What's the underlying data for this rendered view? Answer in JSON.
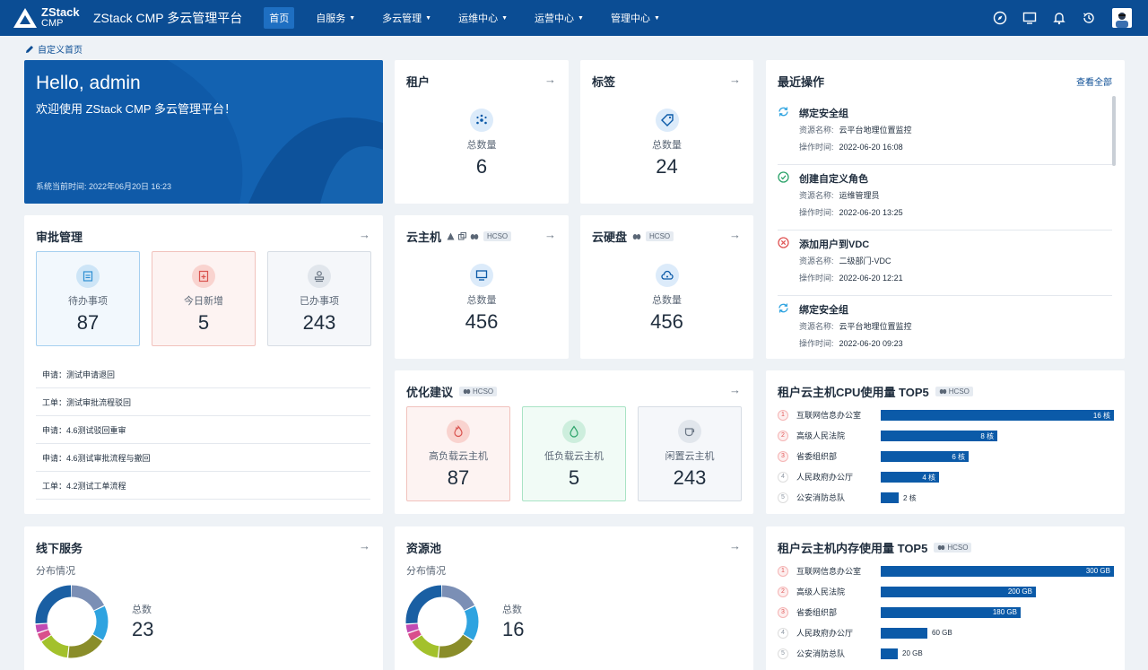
{
  "header": {
    "logo_line1": "ZStack",
    "logo_line2": "CMP",
    "app_title": "ZStack CMP 多云管理平台",
    "nav": [
      {
        "label": "首页"
      },
      {
        "label": "自服务"
      },
      {
        "label": "多云管理"
      },
      {
        "label": "运维中心"
      },
      {
        "label": "运营中心"
      },
      {
        "label": "管理中心"
      }
    ],
    "icons": [
      "compass-icon",
      "monitor-icon",
      "bell-icon",
      "history-icon",
      "avatar"
    ]
  },
  "customize_label": "自定义首页",
  "hello": {
    "title": "Hello, admin",
    "subtitle": "欢迎使用 ZStack CMP 多云管理平台！",
    "time": "系统当前时间:  2022年06月20日 16:23"
  },
  "tenant": {
    "title": "租户",
    "label": "总数量",
    "value": "6"
  },
  "tag": {
    "title": "标签",
    "label": "总数量",
    "value": "24"
  },
  "vm": {
    "title": "云主机",
    "label": "总数量",
    "value": "456",
    "badge": "HCSO"
  },
  "disk": {
    "title": "云硬盘",
    "label": "总数量",
    "value": "456",
    "badge": "HCSO"
  },
  "approval": {
    "title": "审批管理",
    "boxes": [
      {
        "label": "待办事项",
        "value": "87"
      },
      {
        "label": "今日新增",
        "value": "5"
      },
      {
        "label": "已办事项",
        "value": "243"
      }
    ],
    "items": [
      {
        "text": "申请：测试申请退回"
      },
      {
        "text": "工单：测试审批流程驳回"
      },
      {
        "text": "申请：4.6测试驳回重审"
      },
      {
        "text": "申请：4.6测试审批流程与撤回"
      },
      {
        "text": "工单：4.2测试工单流程"
      }
    ]
  },
  "optimize": {
    "title": "优化建议",
    "badge": "HCSO",
    "boxes": [
      {
        "label": "高负载云主机",
        "value": "87"
      },
      {
        "label": "低负载云主机",
        "value": "5"
      },
      {
        "label": "闲置云主机",
        "value": "243"
      }
    ]
  },
  "recent": {
    "title": "最近操作",
    "view_all": "查看全部",
    "res_key": "资源名称:",
    "time_key": "操作时间:",
    "ops": [
      {
        "name": "绑定安全组",
        "resource": "云平台地理位置监控",
        "time": "2022-06-20 16:08",
        "status": "sync"
      },
      {
        "name": "创建自定义角色",
        "resource": "运维管理员",
        "time": "2022-06-20 13:25",
        "status": "success"
      },
      {
        "name": "添加用户到VDC",
        "resource": "二级部门-VDC",
        "time": "2022-06-20 12:21",
        "status": "fail"
      },
      {
        "name": "绑定安全组",
        "resource": "云平台地理位置监控",
        "time": "2022-06-20 09:23",
        "status": "sync"
      }
    ]
  },
  "cpu_top5": {
    "title": "租户云主机CPU使用量 TOP5",
    "badge": "HCSO",
    "rows": [
      {
        "rank": "1",
        "name": "互联网信息办公室",
        "value": 16,
        "label": "16 核"
      },
      {
        "rank": "2",
        "name": "高级人民法院",
        "value": 8,
        "label": "8 核"
      },
      {
        "rank": "3",
        "name": "省委组织部",
        "value": 6,
        "label": "6 核"
      },
      {
        "rank": "4",
        "name": "人民政府办公厅",
        "value": 4,
        "label": "4 核"
      },
      {
        "rank": "5",
        "name": "公安消防总队",
        "value": 1.2,
        "label": "2 核"
      }
    ],
    "max": 16
  },
  "mem_top5": {
    "title": "租户云主机内存使用量 TOP5",
    "badge": "HCSO",
    "rows": [
      {
        "rank": "1",
        "name": "互联网信息办公室",
        "value": 300,
        "label": "300 GB"
      },
      {
        "rank": "2",
        "name": "高级人民法院",
        "value": 200,
        "label": "200 GB"
      },
      {
        "rank": "3",
        "name": "省委组织部",
        "value": 180,
        "label": "180 GB"
      },
      {
        "rank": "4",
        "name": "人民政府办公厅",
        "value": 60,
        "label": "60 GB"
      },
      {
        "rank": "5",
        "name": "公安消防总队",
        "value": 22,
        "label": "20 GB"
      }
    ],
    "max": 300
  },
  "offline": {
    "title": "线下服务",
    "dist_label": "分布情况",
    "total_label": "总数",
    "total": "23",
    "segments": [
      {
        "value": 18,
        "color": "#7b8fb5"
      },
      {
        "value": 16,
        "color": "#2ea3e0"
      },
      {
        "value": 18,
        "color": "#8a8d2a"
      },
      {
        "value": 14,
        "color": "#a3c12c"
      },
      {
        "value": 4,
        "color": "#d94f8c"
      },
      {
        "value": 4,
        "color": "#c24bb3"
      },
      {
        "value": 26,
        "color": "#1a5fa3"
      }
    ]
  },
  "pool": {
    "title": "资源池",
    "dist_label": "分布情况",
    "total_label": "总数",
    "total": "16",
    "segments": [
      {
        "value": 18,
        "color": "#7b8fb5"
      },
      {
        "value": 16,
        "color": "#2ea3e0"
      },
      {
        "value": 18,
        "color": "#8a8d2a"
      },
      {
        "value": 14,
        "color": "#a3c12c"
      },
      {
        "value": 4,
        "color": "#d94f8c"
      },
      {
        "value": 4,
        "color": "#c24bb3"
      },
      {
        "value": 26,
        "color": "#1a5fa3"
      }
    ]
  }
}
